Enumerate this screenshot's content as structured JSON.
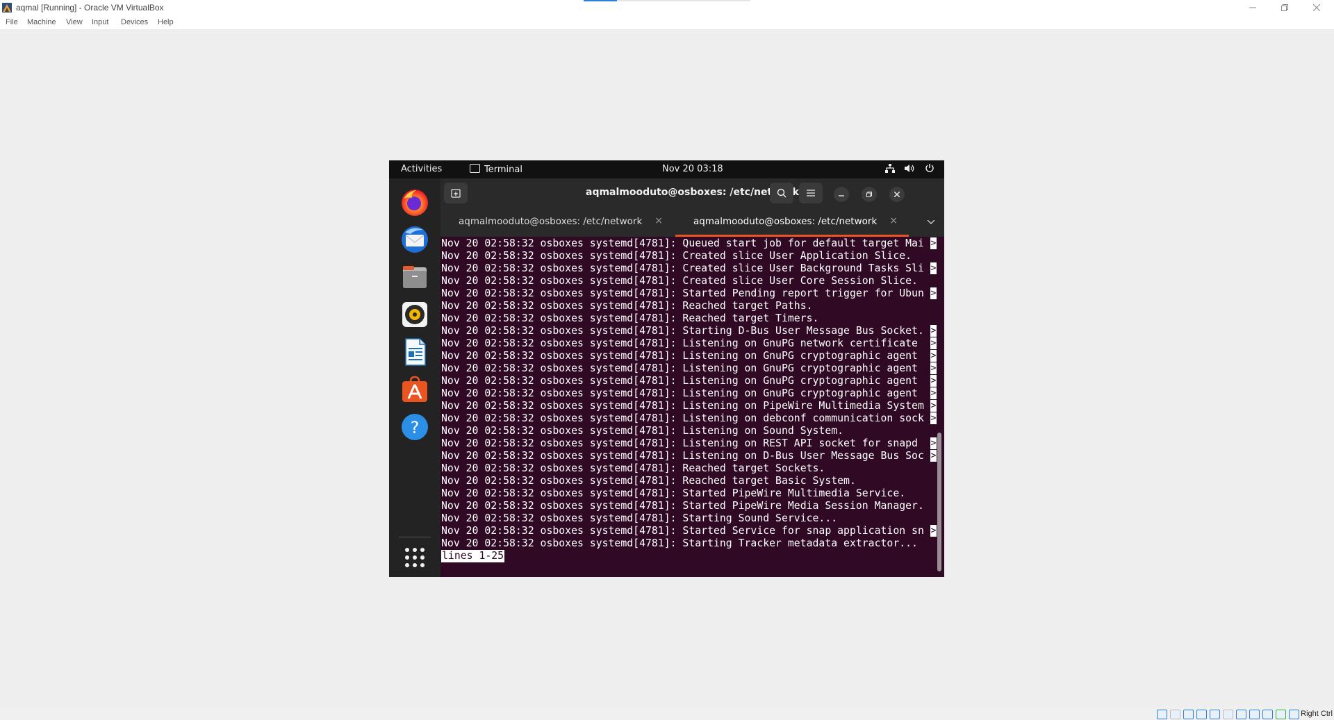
{
  "host": {
    "title": "aqmal [Running] - Oracle VM VirtualBox",
    "menu": [
      "File",
      "Machine",
      "View",
      "Input",
      "Devices",
      "Help"
    ],
    "host_key_label": "Right Ctrl",
    "status_icons": [
      "hard-disk-icon",
      "optical-disk-icon",
      "audio-icon",
      "network-icon",
      "usb-icon",
      "shared-folder-icon",
      "display-icon",
      "video-capture-icon",
      "virtualization-icon",
      "mouse-integration-icon",
      "keyboard-capture-icon"
    ]
  },
  "guest": {
    "topbar": {
      "activities": "Activities",
      "app_name": "Terminal",
      "clock": "Nov 20  03:18"
    },
    "dock": [
      "firefox",
      "thunderbird",
      "files",
      "rhythmbox",
      "libreoffice-writer",
      "ubuntu-software",
      "help"
    ],
    "terminal": {
      "title": "aqmalmooduto@osboxes: /etc/network",
      "tabs": [
        {
          "label": "aqmalmooduto@osboxes: /etc/network",
          "active": false
        },
        {
          "label": "aqmalmooduto@osboxes: /etc/network",
          "active": true
        }
      ],
      "lines": [
        "Nov 20 02:58:32 osboxes systemd[4781]: Queued start job for default target Mai",
        "Nov 20 02:58:32 osboxes systemd[4781]: Created slice User Application Slice.",
        "Nov 20 02:58:32 osboxes systemd[4781]: Created slice User Background Tasks Sli",
        "Nov 20 02:58:32 osboxes systemd[4781]: Created slice User Core Session Slice.",
        "Nov 20 02:58:32 osboxes systemd[4781]: Started Pending report trigger for Ubun",
        "Nov 20 02:58:32 osboxes systemd[4781]: Reached target Paths.",
        "Nov 20 02:58:32 osboxes systemd[4781]: Reached target Timers.",
        "Nov 20 02:58:32 osboxes systemd[4781]: Starting D-Bus User Message Bus Socket.",
        "Nov 20 02:58:32 osboxes systemd[4781]: Listening on GnuPG network certificate ",
        "Nov 20 02:58:32 osboxes systemd[4781]: Listening on GnuPG cryptographic agent ",
        "Nov 20 02:58:32 osboxes systemd[4781]: Listening on GnuPG cryptographic agent ",
        "Nov 20 02:58:32 osboxes systemd[4781]: Listening on GnuPG cryptographic agent ",
        "Nov 20 02:58:32 osboxes systemd[4781]: Listening on GnuPG cryptographic agent ",
        "Nov 20 02:58:32 osboxes systemd[4781]: Listening on PipeWire Multimedia System",
        "Nov 20 02:58:32 osboxes systemd[4781]: Listening on debconf communication sock",
        "Nov 20 02:58:32 osboxes systemd[4781]: Listening on Sound System.",
        "Nov 20 02:58:32 osboxes systemd[4781]: Listening on REST API socket for snapd ",
        "Nov 20 02:58:32 osboxes systemd[4781]: Listening on D-Bus User Message Bus Soc",
        "Nov 20 02:58:32 osboxes systemd[4781]: Reached target Sockets.",
        "Nov 20 02:58:32 osboxes systemd[4781]: Reached target Basic System.",
        "Nov 20 02:58:32 osboxes systemd[4781]: Started PipeWire Multimedia Service.",
        "Nov 20 02:58:32 osboxes systemd[4781]: Started PipeWire Media Session Manager.",
        "Nov 20 02:58:32 osboxes systemd[4781]: Starting Sound Service...",
        "Nov 20 02:58:32 osboxes systemd[4781]: Started Service for snap application sn",
        "Nov 20 02:58:32 osboxes systemd[4781]: Starting Tracker metadata extractor..."
      ],
      "truncated_marker": ">",
      "truncated_rows": [
        0,
        2,
        4,
        7,
        8,
        9,
        10,
        11,
        12,
        13,
        14,
        16,
        17,
        23
      ],
      "pager_status": "lines 1-25"
    }
  }
}
